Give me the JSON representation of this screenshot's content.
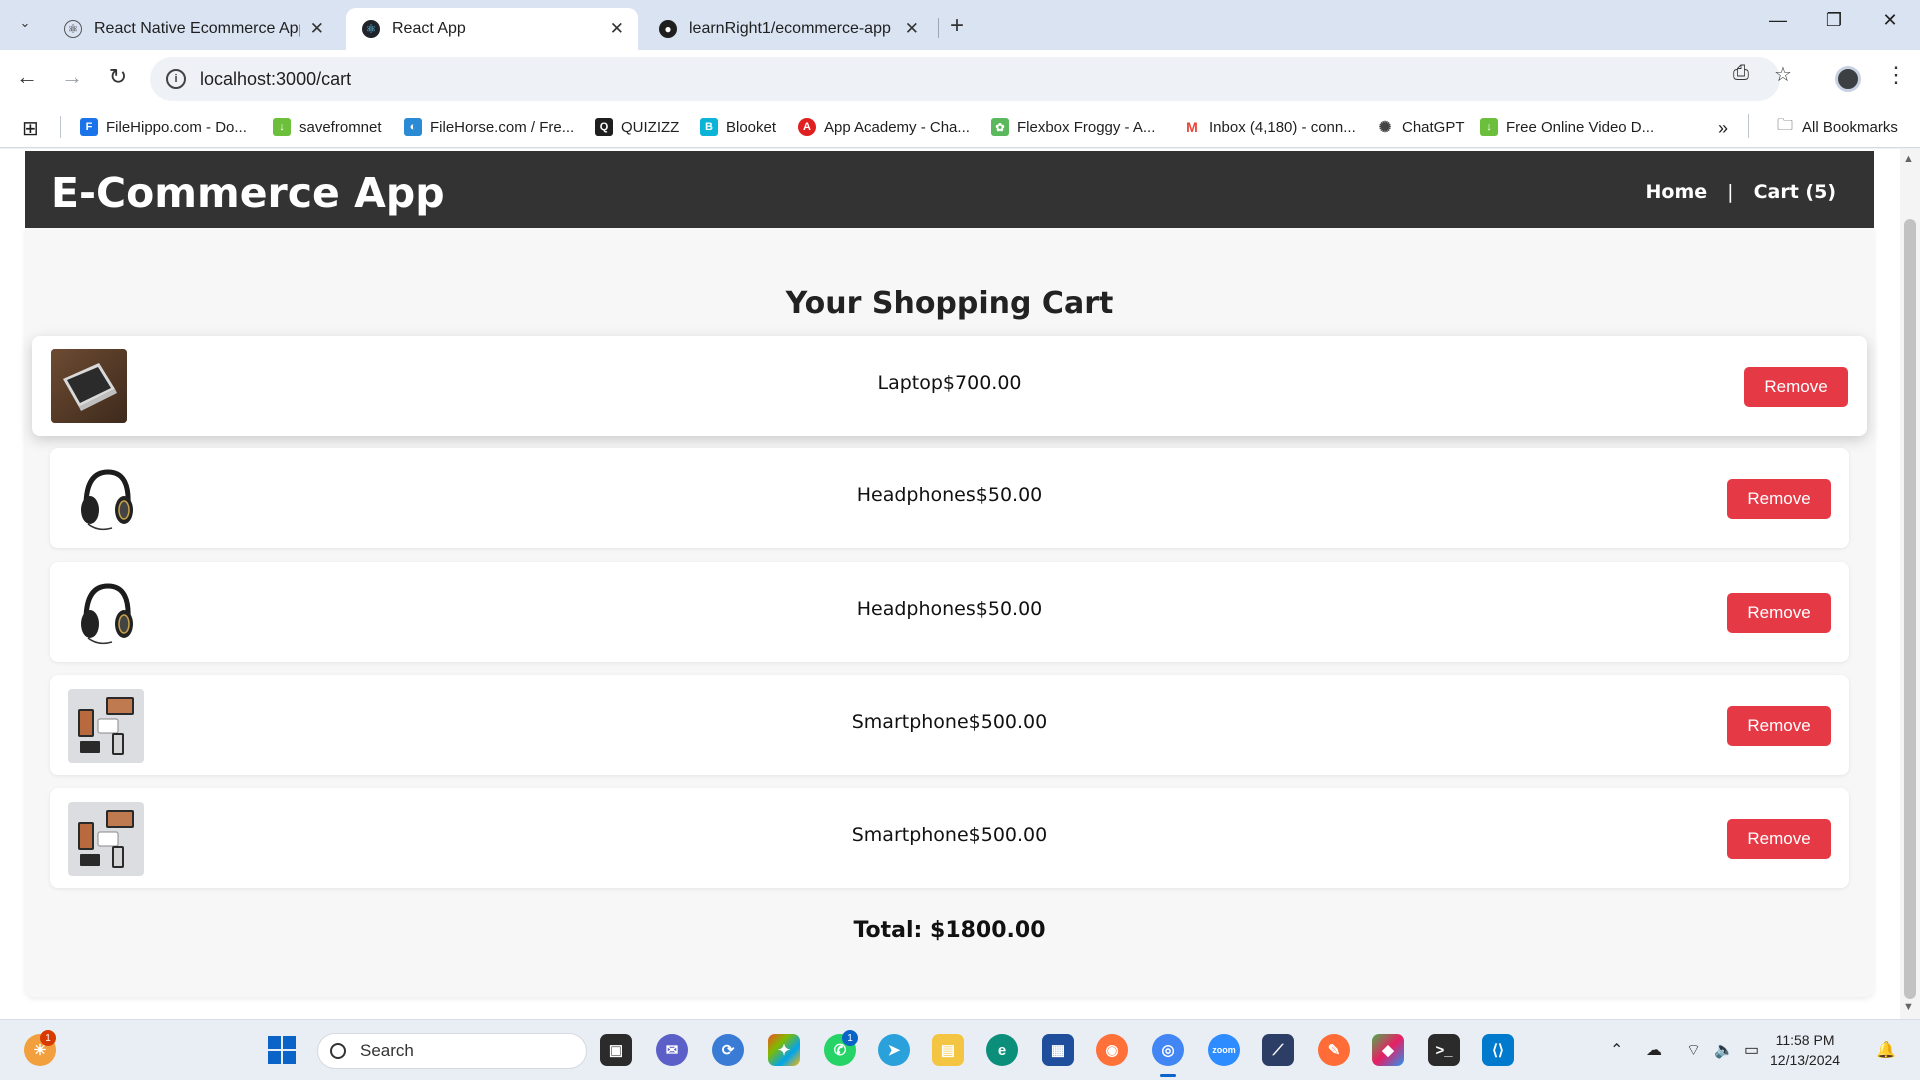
{
  "browser": {
    "tabs": [
      {
        "title": "React Native Ecommerce App",
        "icon": "react-icon",
        "active": false
      },
      {
        "title": "React App",
        "icon": "react-icon",
        "active": true
      },
      {
        "title": "learnRight1/ecommerce-app",
        "icon": "github-icon",
        "active": false
      }
    ],
    "url": "localhost:3000/cart",
    "bookmarks": [
      {
        "label": "FileHippo.com - Do...",
        "color": "#1a73e8"
      },
      {
        "label": "savefromnet",
        "color": "#6cbf3a"
      },
      {
        "label": "FileHorse.com / Fre...",
        "color": "#2a8bd4"
      },
      {
        "label": "QUIZIZZ",
        "color": "#1f1f1f"
      },
      {
        "label": "Blooket",
        "color": "#0bb4d6"
      },
      {
        "label": "App Academy - Cha...",
        "color": "#e02020"
      },
      {
        "label": "Flexbox Froggy - A...",
        "color": "#5cb85c"
      },
      {
        "label": "Inbox (4,180) - conn...",
        "color": "#ea4335"
      },
      {
        "label": "ChatGPT",
        "color": "#444444"
      },
      {
        "label": "Free Online Video D...",
        "color": "#6cbf3a"
      }
    ],
    "all_bookmarks_label": "All Bookmarks"
  },
  "app": {
    "title": "E-Commerce App",
    "nav": {
      "home": "Home",
      "separator": "|",
      "cart": "Cart (5)"
    },
    "cart_title": "Your Shopping Cart",
    "items": [
      {
        "name": "Laptop",
        "price": "$700.00",
        "text": "Laptop$700.00",
        "image": "laptop-image"
      },
      {
        "name": "Headphones",
        "price": "$50.00",
        "text": "Headphones$50.00",
        "image": "headphones-image"
      },
      {
        "name": "Headphones",
        "price": "$50.00",
        "text": "Headphones$50.00",
        "image": "headphones-image"
      },
      {
        "name": "Smartphone",
        "price": "$500.00",
        "text": "Smartphone$500.00",
        "image": "smartphone-image"
      },
      {
        "name": "Smartphone",
        "price": "$500.00",
        "text": "Smartphone$500.00",
        "image": "smartphone-image"
      }
    ],
    "remove_label": "Remove",
    "total": "Total: $1800.00",
    "accent_color": "#e63946"
  },
  "taskbar": {
    "search_label": "Search",
    "time": "11:58 PM",
    "date": "12/13/2024",
    "weather_badge": "1",
    "whatsapp_badge": "1"
  }
}
